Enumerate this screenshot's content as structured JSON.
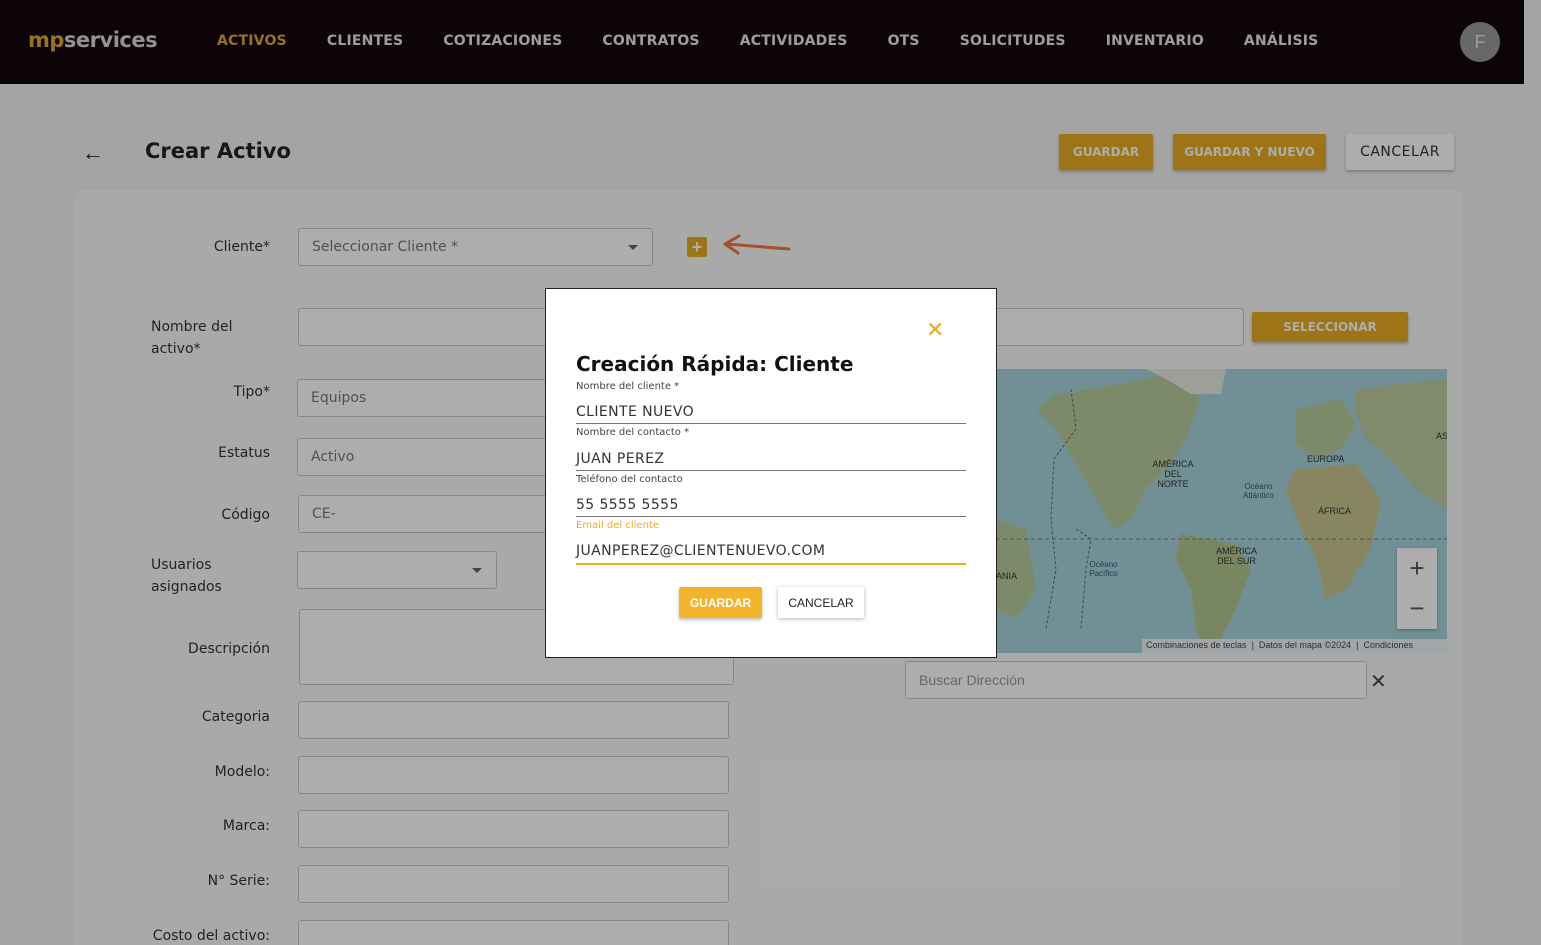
{
  "app": {
    "logo_prefix": "mp",
    "logo_suffix": "services",
    "avatar_initial": "F"
  },
  "nav": {
    "items": [
      "ACTIVOS",
      "CLIENTES",
      "COTIZACIONES",
      "CONTRATOS",
      "ACTIVIDADES",
      "OTS",
      "SOLICITUDES",
      "INVENTARIO",
      "ANÁLISIS"
    ],
    "active": "ACTIVOS"
  },
  "header": {
    "title": "Crear Activo",
    "save": "GUARDAR",
    "save_new": "GUARDAR Y NUEVO",
    "cancel": "CANCELAR"
  },
  "form": {
    "cliente_label": "Cliente*",
    "cliente_placeholder": "Seleccionar Cliente *",
    "nombre_label_1": "Nombre del",
    "nombre_label_2": "activo*",
    "tipo_label": "Tipo*",
    "tipo_value": "Equipos",
    "estatus_label": "Estatus",
    "estatus_value": "Activo",
    "codigo_label": "Código",
    "codigo_value": "CE-",
    "usuarios_label_1": "Usuarios",
    "usuarios_label_2": "asignados",
    "descripcion_label": "Descripción",
    "categoria_label": "Categoria",
    "modelo_label": "Modelo:",
    "marca_label": "Marca:",
    "serie_label": "N° Serie:",
    "costo_label": "Costo del activo:",
    "seleccionar_button": "SELECCIONAR"
  },
  "map": {
    "labels": [
      "AMÉRICA DEL NORTE",
      "EUROPA",
      "Océano Atlántico",
      "ÁFRICA",
      "AMÉRICA DEL SUR",
      "Océano Pacífico",
      "ANIA",
      "AS"
    ],
    "footer": [
      "Combinaciones de teclas",
      "Datos del mapa ©2024",
      "Condiciones"
    ],
    "zoom_in": "+",
    "zoom_out": "−",
    "search_placeholder": "Buscar Dirección"
  },
  "modal": {
    "title": "Creación Rápida: Cliente",
    "fields": [
      {
        "label": "Nombre del cliente *",
        "value": "CLIENTE NUEVO"
      },
      {
        "label": "Nombre del contacto *",
        "value": "JUAN PEREZ"
      },
      {
        "label": "Teléfono del contacto",
        "value": "55 5555 5555"
      },
      {
        "label": "Email del cliente",
        "value": "JUANPEREZ@CLIENTENUEVO.COM"
      }
    ],
    "save": "GUARDAR",
    "cancel": "CANCELAR"
  },
  "colors": {
    "accent": "#e7ad22",
    "topbar": "#14060f",
    "annotation_arrow": "#f07a3a"
  }
}
